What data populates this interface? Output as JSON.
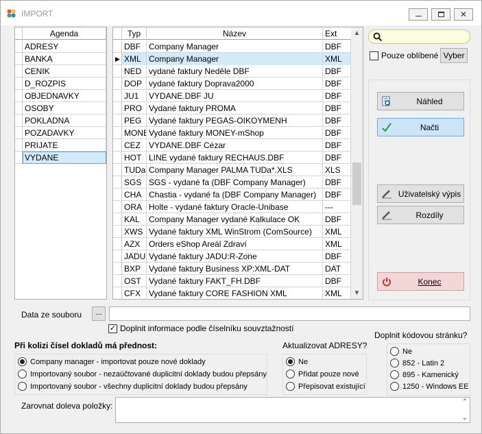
{
  "window": {
    "title": "IMPORT"
  },
  "agenda": {
    "header": "Agenda",
    "items": [
      "ADRESY",
      "BANKA",
      "CENIK",
      "D_ROZPIS",
      "OBJEDNAVKY",
      "OSOBY",
      "POKLADNA",
      "POZADAVKY",
      "PRIJATE",
      "VYDANE"
    ],
    "selected": "VYDANE"
  },
  "formats": {
    "headers": {
      "typ": "Typ",
      "nazev": "Název",
      "ext": "Ext"
    },
    "rows": [
      {
        "typ": "DBF",
        "nazev": "Company Manager",
        "ext": "DBF"
      },
      {
        "typ": "XML",
        "nazev": "Company Manager",
        "ext": "XML"
      },
      {
        "typ": "NED",
        "nazev": "vydané faktury Neděle DBF",
        "ext": "DBF"
      },
      {
        "typ": "DOP",
        "nazev": "vydané faktury Doprava2000",
        "ext": "DBF"
      },
      {
        "typ": "JU1",
        "nazev": "VYDANE.DBF JU",
        "ext": "DBF"
      },
      {
        "typ": "PRO",
        "nazev": "Vydané faktury PROMA",
        "ext": "DBF"
      },
      {
        "typ": "PEG",
        "nazev": "Vydané faktury PEGAS-OIKOYMENH",
        "ext": "DBF"
      },
      {
        "typ": "MONEY",
        "nazev": "Vydané faktury MONEY-mShop",
        "ext": "DBF"
      },
      {
        "typ": "CEZ",
        "nazev": "VYDANE.DBF Cézar",
        "ext": "DBF"
      },
      {
        "typ": "HOT",
        "nazev": "LINE vydané faktury RECHAUS.DBF",
        "ext": "DBF"
      },
      {
        "typ": "TUDa",
        "nazev": "Company Manager PALMA TUDa*.XLS",
        "ext": "XLS"
      },
      {
        "typ": "SGS",
        "nazev": "SGS - vydané fa (DBF Company Manager)",
        "ext": "DBF"
      },
      {
        "typ": "CHA",
        "nazev": "Chastia - vydané fa (DBF Company Manager)",
        "ext": "DBF"
      },
      {
        "typ": "ORA",
        "nazev": "Holte - vydané faktury Oracle-Unibase",
        "ext": "---"
      },
      {
        "typ": "KAL",
        "nazev": "Company Manager vydané Kalkulace OK",
        "ext": "DBF"
      },
      {
        "typ": "XWS",
        "nazev": "Vydané faktury XML WinStrom (ComSource)",
        "ext": "XML"
      },
      {
        "typ": "AZX",
        "nazev": "Orders eShop Areál Zdraví",
        "ext": "XML"
      },
      {
        "typ": "JADU",
        "nazev": "Vydané faktury JADU:R-Zone",
        "ext": "DBF"
      },
      {
        "typ": "BXP",
        "nazev": "Vydané faktury Business XP:XML-DAT",
        "ext": "DAT"
      },
      {
        "typ": "OST",
        "nazev": "Vydané faktury FAKT_FH.DBF",
        "ext": "DBF"
      },
      {
        "typ": "CFX",
        "nazev": "Vydané faktury CORE FASHION XML",
        "ext": "XML"
      }
    ],
    "selected_index": 1,
    "scroll_fraction": 0.6
  },
  "search": {
    "value": "",
    "placeholder": ""
  },
  "favorites": {
    "label": "Pouze oblíbené",
    "checked": false,
    "select_label": "Vyber"
  },
  "buttons": {
    "nahled": "Náhled",
    "nacti": "Načti",
    "uzivatelsky_vypis": "Uživatelský výpis",
    "rozdily": "Rozdíly",
    "konec": "Konec"
  },
  "file": {
    "label": "Data ze souboru",
    "browse": "...",
    "value": ""
  },
  "doplnit": {
    "label": "Doplnit informace podle číselníku souvztažností",
    "checked": true
  },
  "kolize": {
    "title": "Při kolizi čísel dokladů má přednost:",
    "options": [
      "Company manager - importovat pouze nové doklady",
      "Importovaný soubor - nezaúčtované duplicitní doklady budou přepsány",
      "Importovaný soubor - všechny duplicitní doklady budou přepsány"
    ],
    "selected": 0
  },
  "adresy": {
    "title": "Aktualizovat ADRESY?",
    "options": [
      "Ne",
      "Přidat pouze nové",
      "Přepisovat existující"
    ],
    "selected": 0
  },
  "kodova": {
    "title": "Doplnit kódovou stránku?",
    "options": [
      "Ne",
      "852 - Latin 2",
      "895 - Kamenický",
      "1250 - Windows EE"
    ],
    "selected": -1
  },
  "zarovnat": {
    "label": "Zarovnat doleva položky:",
    "value": ""
  },
  "colors": {
    "selection": "#d3eaf8",
    "selection_border": "#5ba4dc",
    "konec_bg": "#f4d6d6",
    "nacti_bg": "#cce4f7"
  },
  "icons": {
    "app": "app-icon",
    "minimize": "minimize-icon",
    "maximize": "maximize-icon",
    "close": "close-icon",
    "search": "search-icon",
    "nahled": "preview-icon",
    "nacti": "checkmark-icon",
    "uzivatelsky": "pen-icon",
    "rozdily": "pen-icon",
    "konec": "power-icon"
  }
}
